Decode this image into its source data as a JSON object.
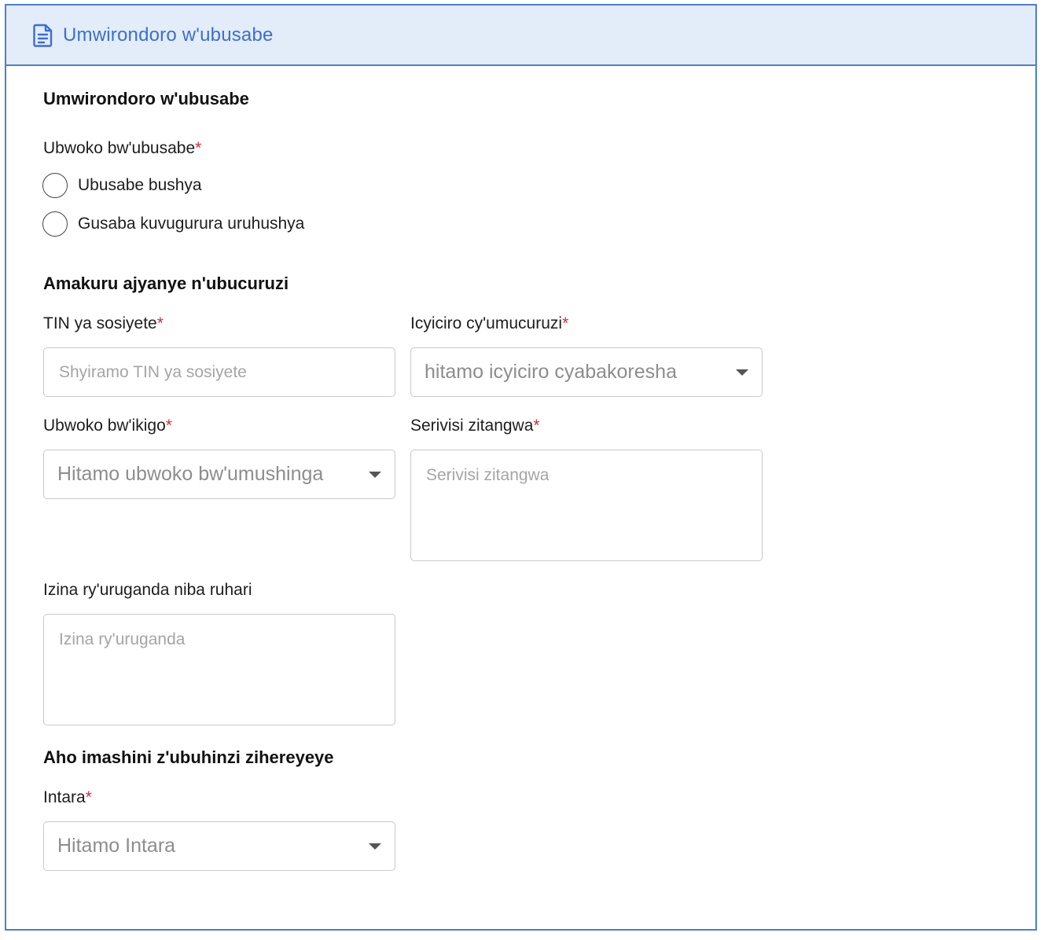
{
  "header": {
    "icon": "document-icon",
    "title": "Umwirondoro w'ubusabe"
  },
  "application_section": {
    "title": "Umwirondoro w'ubusabe",
    "type_label": "Ubwoko bw'ubusabe",
    "required_mark": "*",
    "options": [
      {
        "label": "Ubusabe bushya",
        "selected": false
      },
      {
        "label": "Gusaba kuvugurura uruhushya",
        "selected": false
      }
    ]
  },
  "business_section": {
    "title": "Amakuru ajyanye n'ubucuruzi",
    "tin": {
      "label": "TIN ya sosiyete",
      "placeholder": "Shyiramo TIN ya sosiyete",
      "value": ""
    },
    "trader_category": {
      "label": "Icyiciro cy'umucuruzi",
      "placeholder": "hitamo icyiciro cyabakoresha"
    },
    "project_type": {
      "label": "Ubwoko bw'ikigo",
      "placeholder": "Hitamo ubwoko bw'umushinga"
    },
    "services": {
      "label": "Serivisi zitangwa",
      "placeholder": "Serivisi zitangwa",
      "value": ""
    },
    "company_name": {
      "label": "Izina ry'uruganda niba ruhari",
      "placeholder": "Izina ry'uruganda",
      "value": ""
    }
  },
  "location_section": {
    "title": "Aho imashini z'ubuhinzi zihereyeye",
    "province": {
      "label": "Intara",
      "placeholder": "Hitamo Intara"
    }
  },
  "colors": {
    "accent": "#3b6fcf",
    "border_accent": "#4a7ed4",
    "header_bg": "#e3ecf9",
    "required": "#d9283a"
  }
}
